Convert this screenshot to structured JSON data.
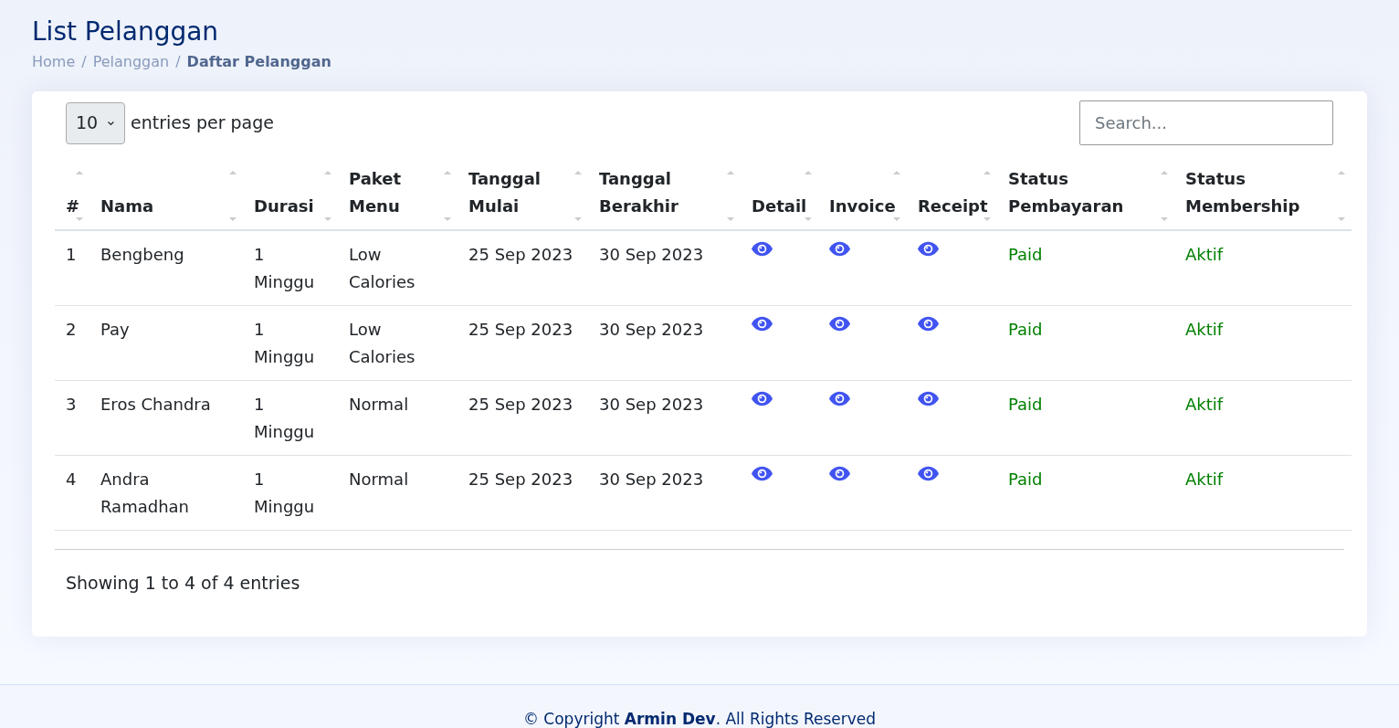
{
  "page_title": "List Pelanggan",
  "breadcrumb": [
    {
      "label": "Home",
      "current": false
    },
    {
      "separator": "/",
      "label": "Pelanggan",
      "current": false
    },
    {
      "separator": "/",
      "label": "Daftar Pelanggan",
      "current": true
    }
  ],
  "page_size": {
    "value": "10",
    "label": "entries per page"
  },
  "search": {
    "placeholder": "Search..."
  },
  "table": {
    "columns": [
      {
        "label": "#",
        "kind": "text"
      },
      {
        "label": "Nama",
        "kind": "text"
      },
      {
        "label": "Durasi",
        "kind": "text"
      },
      {
        "label": "Paket Menu",
        "kind": "text"
      },
      {
        "label": "Tanggal Mulai",
        "kind": "text"
      },
      {
        "label": "Tanggal Berakhir",
        "kind": "text"
      },
      {
        "label": "Detail",
        "kind": "action"
      },
      {
        "label": "Invoice",
        "kind": "action"
      },
      {
        "label": "Receipt",
        "kind": "action"
      },
      {
        "label": "Status Pembayaran",
        "kind": "status"
      },
      {
        "label": "Status Membership",
        "kind": "status"
      }
    ],
    "rows": [
      [
        "1",
        "Bengbeng",
        "1 Minggu",
        "Low Calories",
        "25 Sep 2023",
        "30 Sep 2023",
        "Paid",
        "Aktif"
      ],
      [
        "2",
        "Pay",
        "1 Minggu",
        "Low Calories",
        "25 Sep 2023",
        "30 Sep 2023",
        "Paid",
        "Aktif"
      ],
      [
        "3",
        "Eros Chandra",
        "1 Minggu",
        "Normal",
        "25 Sep 2023",
        "30 Sep 2023",
        "Paid",
        "Aktif"
      ],
      [
        "4",
        "Andra Ramadhan",
        "1 Minggu",
        "Normal",
        "25 Sep 2023",
        "30 Sep 2023",
        "Paid",
        "Aktif"
      ]
    ]
  },
  "table_info": "Showing 1 to 4 of 4 entries",
  "footer": "© Copyright **Armin Dev**. All Rights Reserved"
}
